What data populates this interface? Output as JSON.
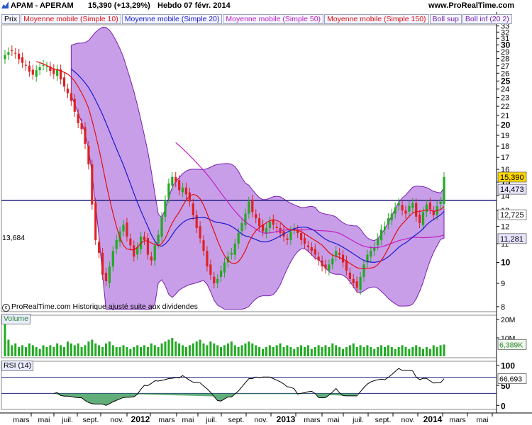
{
  "header": {
    "symbol": "APAM - APERAM",
    "price_change": "15,390 (+13,29%)",
    "period_date": "Hebdo  07 févr. 2014",
    "site": "www.ProRealTime.com"
  },
  "legend": [
    {
      "label": "Prix",
      "color": "#000000"
    },
    {
      "label": "Moyenne mobile (Simple 10)",
      "color": "#e01010"
    },
    {
      "label": "Moyenne mobile (Simple 20)",
      "color": "#1a1acc"
    },
    {
      "label": "Moyenne mobile (Simple 50)",
      "color": "#c020c0"
    },
    {
      "label": "Moyenne mobile (Simple 150)",
      "color": "#e01010"
    },
    {
      "label": "Boll sup",
      "color": "#7a20b0"
    },
    {
      "label": "Boll inf (20 2)",
      "color": "#7a20b0"
    }
  ],
  "footer_note": "ProRealTime.com  Historique ajusté suite aux dividendes",
  "volume_label": "Volume",
  "rsi_label": "RSI (14)",
  "colors": {
    "up": "#22aa22",
    "down": "#dd2222",
    "band": "#9a4fd6",
    "support": "#202080",
    "rsi_fill": "#3b9a5a"
  },
  "chart_data": [
    {
      "type": "candlestick",
      "id": "price",
      "interval": "weekly",
      "y_axis": {
        "ticks": [
          8,
          9,
          10,
          11,
          12,
          13,
          14,
          15,
          16,
          17,
          18,
          19,
          20,
          21,
          22,
          23,
          24,
          25,
          26,
          27,
          28,
          29,
          30,
          31,
          32,
          33
        ],
        "bold_ticks": [
          10,
          15,
          20,
          25,
          30
        ],
        "range": [
          7.8,
          33.2
        ],
        "scale": "log"
      },
      "x_axis": {
        "ticks": [
          "mars",
          "mai",
          "juil.",
          "sept.",
          "nov.",
          "2012",
          "mars",
          "mai",
          "juil.",
          "sept.",
          "nov.",
          "2013",
          "mars",
          "mai",
          "juil.",
          "sept.",
          "nov.",
          "2014",
          "mars",
          "mai"
        ],
        "bold_ticks": [
          "2012",
          "2013",
          "2014"
        ]
      },
      "support_line": {
        "value": 13.684,
        "label": "13,684"
      },
      "last_values": [
        {
          "label": "15,390",
          "value": 15.39,
          "bg": "#ffd700"
        },
        {
          "label": "14,473",
          "value": 14.473,
          "bg": "#e8e4ff"
        },
        {
          "label": "12,725",
          "value": 12.725,
          "bg": "#ffffff"
        },
        {
          "label": "11,281",
          "value": 11.281,
          "bg": "#e8e4ff"
        }
      ],
      "close": [
        28.5,
        28.9,
        29.1,
        28.7,
        27.9,
        27.4,
        27.0,
        26.2,
        25.8,
        26.4,
        26.8,
        27.1,
        26.9,
        26.3,
        25.9,
        26.5,
        25.2,
        24.3,
        23.5,
        22.6,
        21.4,
        20.2,
        19.6,
        18.2,
        16.4,
        13.4,
        11.2,
        10.5,
        9.4,
        9.1,
        9.8,
        10.6,
        11.2,
        11.7,
        12.1,
        11.4,
        10.9,
        10.3,
        10.8,
        11.4,
        11.2,
        10.4,
        10.1,
        10.9,
        11.5,
        12.6,
        13.7,
        14.9,
        15.4,
        15.0,
        14.4,
        14.6,
        14.1,
        13.6,
        12.7,
        11.9,
        11.3,
        10.6,
        9.8,
        9.4,
        9.0,
        9.2,
        9.6,
        10.0,
        10.3,
        10.5,
        11.0,
        11.6,
        12.2,
        12.8,
        13.6,
        12.9,
        12.5,
        12.0,
        11.7,
        11.9,
        12.3,
        12.1,
        11.9,
        11.6,
        11.4,
        11.2,
        11.7,
        11.9,
        11.6,
        11.2,
        11.0,
        10.8,
        10.6,
        10.4,
        10.1,
        9.8,
        9.7,
        9.9,
        10.2,
        10.6,
        10.4,
        10.0,
        9.6,
        9.2,
        9.0,
        8.8,
        9.3,
        9.9,
        10.4,
        10.6,
        10.8,
        11.3,
        11.8,
        12.0,
        12.5,
        12.8,
        13.2,
        13.5,
        13.0,
        12.8,
        13.3,
        13.5,
        12.6,
        12.2,
        12.9,
        13.4,
        13.1,
        12.7,
        13.3,
        13.58,
        15.39
      ],
      "rsi_placeholder_note": "",
      "ma_first_index": {
        "sma10": 9,
        "sma20": 19,
        "sma50": 49,
        "sma150": 110,
        "boll": 19
      }
    },
    {
      "type": "bar",
      "id": "volume",
      "y_axis": {
        "ticks": [
          "20M",
          "10M"
        ]
      },
      "last_value": {
        "label": "6,389K"
      },
      "values": [
        18,
        9,
        6,
        7,
        5,
        6,
        5,
        7,
        6,
        5,
        4,
        6,
        5,
        6,
        5,
        7,
        6,
        5,
        8,
        7,
        6,
        7,
        5,
        6,
        8,
        9,
        7,
        6,
        5,
        7,
        8,
        6,
        5,
        5,
        6,
        5,
        4,
        5,
        6,
        5,
        6,
        5,
        7,
        6,
        5,
        7,
        8,
        9,
        10,
        8,
        7,
        6,
        5,
        6,
        7,
        8,
        9,
        7,
        6,
        8,
        7,
        6,
        5,
        6,
        7,
        8,
        6,
        5,
        6,
        7,
        8,
        7,
        6,
        5,
        4,
        5,
        6,
        5,
        6,
        7,
        5,
        6,
        5,
        4,
        5,
        6,
        5,
        6,
        4,
        5,
        6,
        5,
        6,
        5,
        7,
        6,
        5,
        4,
        5,
        6,
        7,
        5,
        6,
        5,
        6,
        5,
        4,
        5,
        6,
        5,
        6,
        5,
        4,
        5,
        6,
        5,
        4,
        5,
        6,
        5,
        4,
        5,
        4,
        6,
        5,
        6,
        6.389
      ],
      "unit": "millions"
    },
    {
      "type": "line",
      "id": "rsi",
      "y_axis": {
        "ticks": [
          100,
          50,
          0
        ],
        "range": [
          -10,
          110
        ]
      },
      "levels": [
        70,
        30
      ],
      "last_value": {
        "label": "66,693",
        "value": 66.693
      }
    }
  ]
}
